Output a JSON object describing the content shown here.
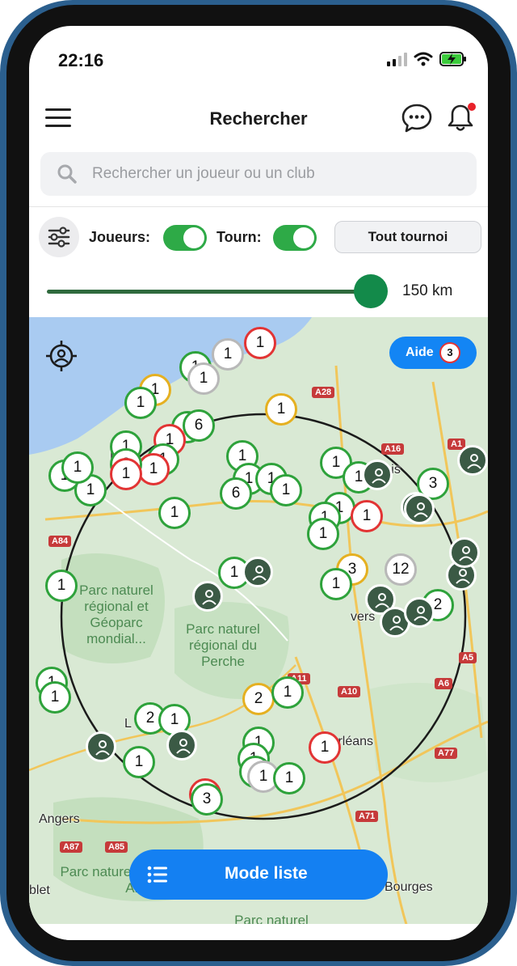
{
  "status": {
    "time": "22:16"
  },
  "header": {
    "title": "Rechercher"
  },
  "search": {
    "placeholder": "Rechercher un joueur ou un club"
  },
  "filters": {
    "players_label": "Joueurs:",
    "tournaments_label": "Tourn:",
    "players_enabled": true,
    "tournaments_enabled": true,
    "all_tournaments_button": "Tout tournoi"
  },
  "radius": {
    "value_label": "150 km",
    "fraction": 1.0
  },
  "map": {
    "help_label": "Aide",
    "help_count": "3",
    "region_labels": {
      "parc1": "Parc naturel régional et Géoparc mondial...",
      "parc2": "Parc naturel régional du Perche",
      "parc3": "Parc naturel régional Loire-Anjou",
      "parc4": "Parc naturel"
    },
    "cities": {
      "orleans": "Orléans",
      "angers": "Angers",
      "bourges": "Bourges",
      "beauvais": "Beauvais",
      "versailles": "vers",
      "le": "Le",
      "le2": "L",
      "blet": "blet"
    },
    "roads": [
      "A28",
      "A16",
      "A1",
      "A84",
      "A11",
      "A10",
      "A6",
      "A5",
      "A77",
      "A71",
      "A87",
      "A85"
    ],
    "markers": [
      {
        "n": "1",
        "c": "red"
      },
      {
        "n": "1",
        "c": "gry"
      },
      {
        "n": "1",
        "c": "green"
      },
      {
        "n": "1",
        "c": "org"
      },
      {
        "n": "1",
        "c": "green"
      },
      {
        "n": "1",
        "c": "green"
      },
      {
        "n": "6",
        "c": "green"
      },
      {
        "n": "1",
        "c": "green"
      },
      {
        "n": "1",
        "c": "red"
      },
      {
        "n": "1",
        "c": "gry"
      },
      {
        "n": "1",
        "c": "green"
      },
      {
        "n": "1",
        "c": "red"
      },
      {
        "n": "1",
        "c": "green"
      },
      {
        "n": "1",
        "c": "green"
      },
      {
        "n": "6",
        "c": "green"
      },
      {
        "n": "1",
        "c": "green"
      },
      {
        "n": "1",
        "c": "green"
      },
      {
        "n": "1",
        "c": "green"
      },
      {
        "n": "1",
        "c": "green"
      },
      {
        "n": "1",
        "c": "green"
      },
      {
        "n": "1",
        "c": "green"
      },
      {
        "n": "1",
        "c": "green"
      },
      {
        "n": "1",
        "c": "green"
      },
      {
        "n": "1",
        "c": "red"
      },
      {
        "n": "3",
        "c": "org"
      },
      {
        "n": "12",
        "c": "gry"
      },
      {
        "n": "1",
        "c": "green"
      },
      {
        "n": "1",
        "c": "green"
      },
      {
        "n": "2",
        "c": "green"
      },
      {
        "n": "3",
        "c": "green"
      },
      {
        "n": "1",
        "c": "green"
      },
      {
        "n": "1",
        "c": "org"
      },
      {
        "n": "1",
        "c": "green"
      },
      {
        "n": "1",
        "c": "green"
      },
      {
        "n": "2",
        "c": "org"
      },
      {
        "n": "1",
        "c": "green"
      },
      {
        "n": "2",
        "c": "green"
      },
      {
        "n": "1",
        "c": "green"
      },
      {
        "n": "1",
        "c": "green"
      },
      {
        "n": "1",
        "c": "green"
      },
      {
        "n": "2",
        "c": "green"
      },
      {
        "n": "1",
        "c": "gry"
      },
      {
        "n": "1",
        "c": "red"
      },
      {
        "n": "1",
        "c": "green"
      },
      {
        "n": "2",
        "c": "red"
      },
      {
        "n": "3",
        "c": "green"
      },
      {
        "n": "1",
        "c": "green"
      },
      {
        "n": "1",
        "c": "green"
      },
      {
        "n": "1",
        "c": "green"
      },
      {
        "n": "2",
        "c": "green"
      },
      {
        "n": "1",
        "c": "green"
      },
      {
        "n": "1",
        "c": "red"
      }
    ]
  },
  "bottom": {
    "mode_list_label": "Mode liste"
  },
  "colors": {
    "accent_blue": "#1480f2",
    "toggle_green": "#2eaa47",
    "marker_green": "#2ea23b",
    "marker_red": "#e23434",
    "marker_orange": "#e5b021"
  }
}
